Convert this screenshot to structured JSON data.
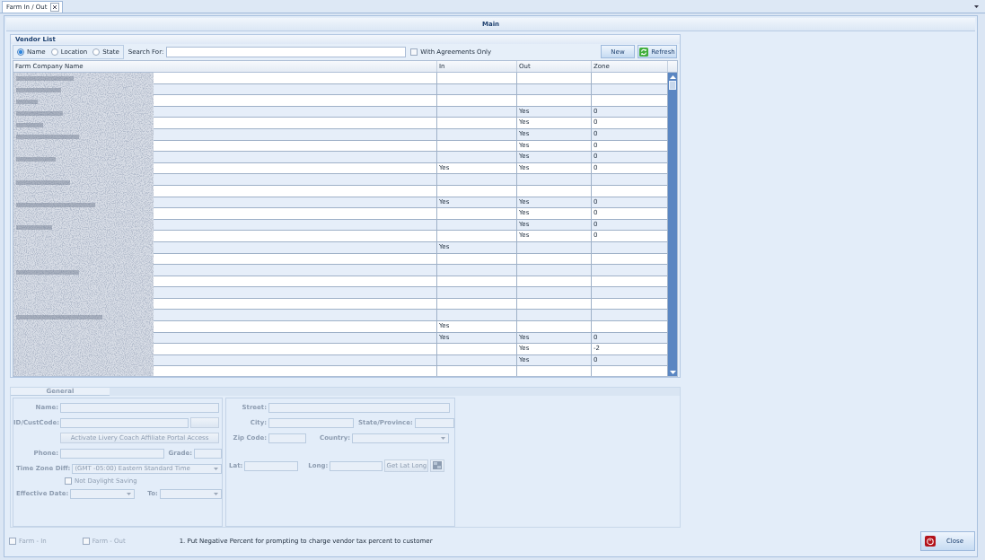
{
  "document_tab": {
    "label": "Farm In / Out",
    "selected": true
  },
  "main_title": "Main",
  "vendor_list": {
    "title": "Vendor List",
    "search_by": [
      {
        "label": "Name",
        "selected": true
      },
      {
        "label": "Location",
        "selected": false
      },
      {
        "label": "State",
        "selected": false
      }
    ],
    "search_label": "Search For:",
    "agreements_only": {
      "label": "With Agreements Only",
      "checked": false
    },
    "buttons": [
      {
        "label": "New",
        "kind": "plain"
      },
      {
        "label": "Refresh",
        "kind": "refresh"
      }
    ]
  },
  "table": {
    "columns": [
      "Farm Company Name",
      "In",
      "Out",
      "Zone"
    ],
    "rows": [
      {},
      {},
      {},
      {
        "out": "Yes",
        "zone": "0"
      },
      {
        "out": "Yes",
        "zone": "0"
      },
      {
        "out": "Yes",
        "zone": "0"
      },
      {
        "out": "Yes",
        "zone": "0"
      },
      {
        "out": "Yes",
        "zone": "0"
      },
      {
        "in": "Yes",
        "out": "Yes",
        "zone": "0"
      },
      {},
      {},
      {
        "in": "Yes",
        "out": "Yes",
        "zone": "0"
      },
      {
        "out": "Yes",
        "zone": "0"
      },
      {
        "out": "Yes",
        "zone": "0"
      },
      {
        "out": "Yes",
        "zone": "0"
      },
      {
        "in": "Yes"
      },
      {},
      {},
      {},
      {},
      {},
      {},
      {
        "in": "Yes"
      },
      {
        "in": "Yes",
        "out": "Yes",
        "zone": "0"
      },
      {
        "out": "Yes",
        "zone": "-2"
      },
      {
        "out": "Yes",
        "zone": "0"
      },
      {}
    ]
  },
  "details": {
    "disabled": true,
    "tabs": [
      {
        "label": "General",
        "selected": true
      }
    ],
    "name_label": "Name:",
    "id_label": "ID/CustCode:",
    "activate_button": "Activate Livery Coach Affiliate Portal Access",
    "phone_label": "Phone:",
    "grade_label": "Grade:",
    "timezone_label": "Time Zone Diff:",
    "timezone_value": "(GMT -05:00) Eastern Standard Time",
    "daylight": {
      "label": "Not Daylight Saving",
      "checked": false
    },
    "effective_label": "Effective Date:",
    "to_label": "To:",
    "street_label": "Street:",
    "city_label": "City:",
    "state_label": "State/Province:",
    "zip_label": "Zip Code:",
    "country_label": "Country:",
    "lat_label": "Lat:",
    "long_label": "Long:",
    "latlong_button": "Get Lat Long"
  },
  "footer": {
    "farm_in": {
      "label": "Farm - In",
      "checked": false,
      "disabled": true
    },
    "farm_out": {
      "label": "Farm - Out",
      "checked": false,
      "disabled": true
    },
    "note": "1. Put Negative Percent for prompting to charge vendor tax percent to customer",
    "close_button": "Close"
  }
}
